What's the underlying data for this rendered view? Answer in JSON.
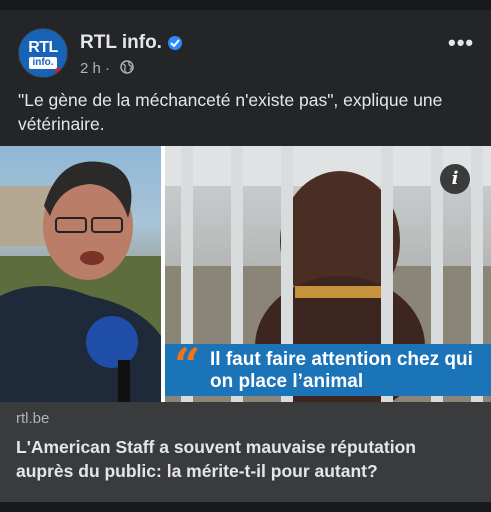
{
  "post": {
    "page_name": "RTL info.",
    "avatar_text_top": "RTL",
    "avatar_text_bottom": "info.",
    "time": "2 h ·",
    "caption": "\"Le gène de la méchanceté n'existe pas\", explique une vétérinaire.",
    "more_label": "•••",
    "icons": [
      "verified-badge-icon",
      "globe-icon",
      "more-options-icon",
      "info-icon"
    ]
  },
  "media": {
    "info_label": "i",
    "quote_mark": "“",
    "quote_text": "Il faut faire attention chez qui on place l’animal"
  },
  "link": {
    "domain": "rtl.be",
    "headline": "L'American Staff a souvent mauvaise réputation auprès du public: la mérite-t-il pour autant?"
  },
  "colors": {
    "background": "#242526",
    "accent_blue": "#2d88ff",
    "quote_band": "#1b73b8",
    "quote_mark": "#f0731c"
  }
}
